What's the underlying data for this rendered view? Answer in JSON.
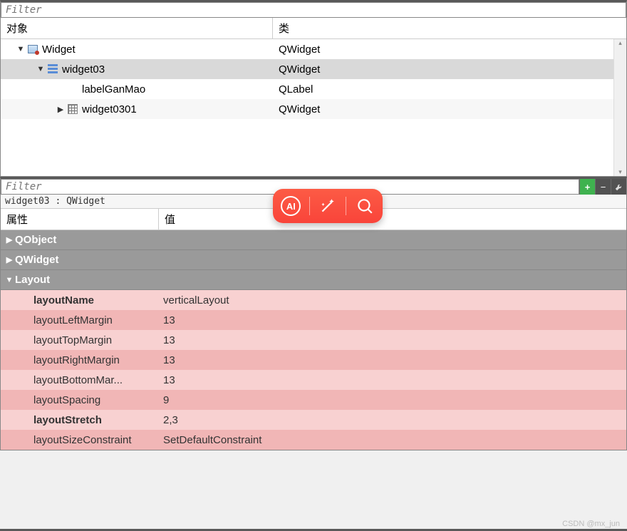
{
  "objectInspector": {
    "filterPlaceholder": "Filter",
    "columns": {
      "object": "对象",
      "class": "类"
    },
    "rows": [
      {
        "indent": 0,
        "expander": "down",
        "icon": "widget-icon",
        "name": "Widget",
        "class": "QWidget",
        "selected": false
      },
      {
        "indent": 1,
        "expander": "down",
        "icon": "layout-icon",
        "name": "widget03",
        "class": "QWidget",
        "selected": true
      },
      {
        "indent": 2,
        "expander": "none",
        "icon": "",
        "name": "labelGanMao",
        "class": "QLabel",
        "selected": false
      },
      {
        "indent": 2,
        "expander": "right",
        "icon": "grid-icon",
        "name": "widget0301",
        "class": "QWidget",
        "selected": false,
        "alt": true
      }
    ]
  },
  "propertyEditor": {
    "filterPlaceholder": "Filter",
    "toolbar": {
      "add": "+",
      "remove": "−",
      "config": "wrench"
    },
    "context": "widget03 : QWidget",
    "columns": {
      "property": "属性",
      "value": "值"
    },
    "groups": [
      {
        "name": "QObject",
        "expanded": false,
        "color": "gray"
      },
      {
        "name": "QWidget",
        "expanded": false,
        "color": "gray"
      },
      {
        "name": "Layout",
        "expanded": true,
        "color": "gray",
        "rows": [
          {
            "name": "layoutName",
            "value": "verticalLayout",
            "bold": true,
            "shade": "a"
          },
          {
            "name": "layoutLeftMargin",
            "value": "13",
            "bold": false,
            "shade": "b"
          },
          {
            "name": "layoutTopMargin",
            "value": "13",
            "bold": false,
            "shade": "a"
          },
          {
            "name": "layoutRightMargin",
            "value": "13",
            "bold": false,
            "shade": "b"
          },
          {
            "name": "layoutBottomMar...",
            "value": "13",
            "bold": false,
            "shade": "a"
          },
          {
            "name": "layoutSpacing",
            "value": "9",
            "bold": false,
            "shade": "b"
          },
          {
            "name": "layoutStretch",
            "value": "2,3",
            "bold": true,
            "shade": "a"
          },
          {
            "name": "layoutSizeConstraint",
            "value": "SetDefaultConstraint",
            "bold": false,
            "shade": "b"
          }
        ]
      }
    ]
  },
  "floatingToolbar": {
    "buttons": [
      "ai-icon",
      "magic-wand-icon",
      "search-icon"
    ]
  },
  "watermark": "CSDN @mx_jun"
}
